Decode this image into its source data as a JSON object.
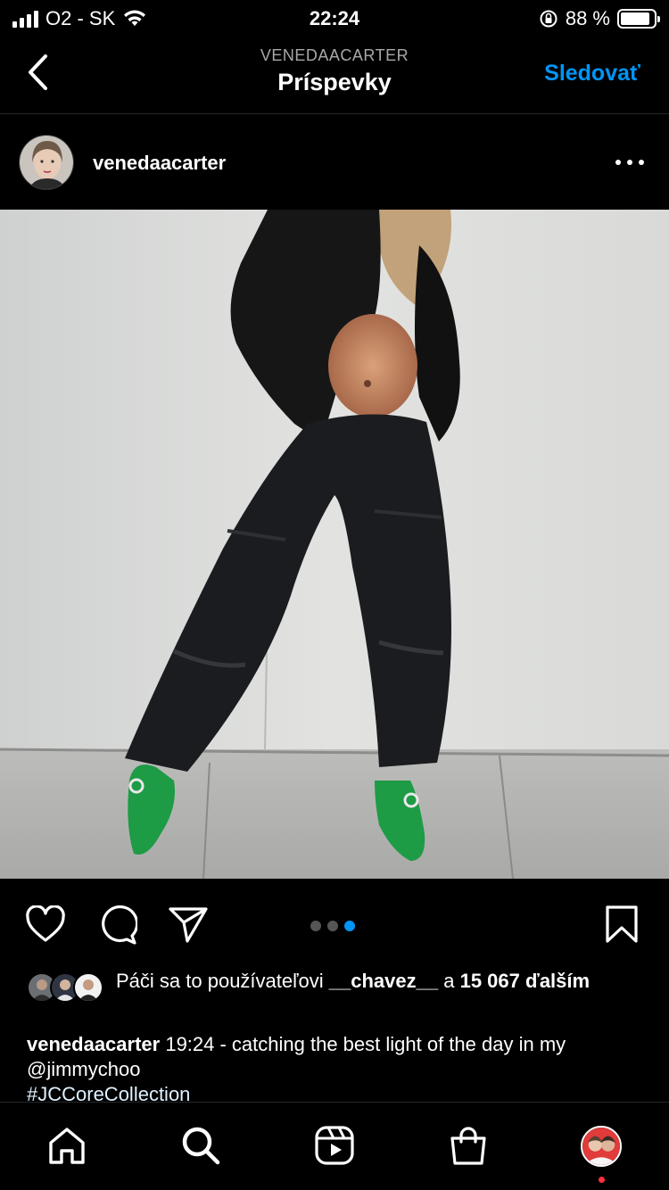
{
  "status_bar": {
    "carrier": "O2 - SK",
    "time": "22:24",
    "battery_percent": "88 %",
    "battery_level": 0.88
  },
  "nav": {
    "subtitle": "VENEDAACARTER",
    "title": "Príspevky",
    "follow_label": "Sledovať"
  },
  "post": {
    "username": "venedaacarter",
    "carousel": {
      "count": 3,
      "active_index": 2
    },
    "likes": {
      "prefix": "Páči sa to používateľovi ",
      "user": "__chavez__",
      "middle": " a ",
      "count": "15 067",
      "suffix": "ďalším"
    },
    "caption": {
      "username": "venedaacarter",
      "text": " 19:24 - catching the best light of the day in my @jimmychoo",
      "hashtag": "#JCCoreCollection"
    }
  },
  "colors": {
    "accent": "#0095f6",
    "background": "#000000",
    "shoe_green": "#1e9b45",
    "notification": "#ff3040"
  },
  "icons": {
    "back": "chevron-left-icon",
    "more": "more-horizontal-icon",
    "like": "heart-icon",
    "comment": "comment-icon",
    "share": "paper-plane-icon",
    "save": "bookmark-icon",
    "home": "home-icon",
    "search": "search-icon",
    "reels": "reels-icon",
    "shop": "shop-bag-icon"
  }
}
